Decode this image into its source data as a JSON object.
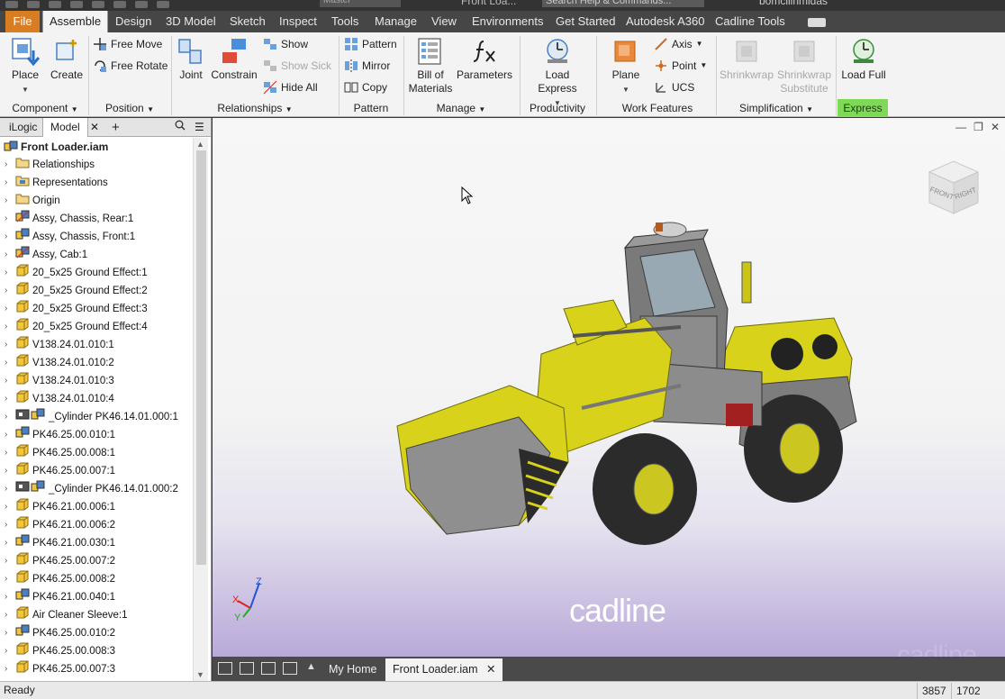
{
  "titlebar": {
    "design_view": "Master",
    "doc_title": "Front Loa...",
    "search_placeholder": "Search Help & Commands...",
    "user": "bomcilinmidas"
  },
  "tabs": {
    "file": "File",
    "items": [
      "Assemble",
      "Design",
      "3D Model",
      "Sketch",
      "Inspect",
      "Tools",
      "Manage",
      "View",
      "Environments",
      "Get Started",
      "Autodesk A360",
      "Cadline Tools"
    ]
  },
  "ribbon": {
    "component": {
      "place": "Place",
      "create": "Create",
      "label": "Component"
    },
    "position": {
      "free_move": "Free Move",
      "free_rotate": "Free Rotate",
      "label": "Position"
    },
    "relationships": {
      "joint": "Joint",
      "constrain": "Constrain",
      "show": "Show",
      "show_sick": "Show Sick",
      "hide_all": "Hide All",
      "label": "Relationships"
    },
    "pattern": {
      "pattern": "Pattern",
      "mirror": "Mirror",
      "copy": "Copy",
      "label": "Pattern"
    },
    "manage": {
      "bom_line1": "Bill of",
      "bom_line2": "Materials",
      "parameters": "Parameters",
      "label": "Manage"
    },
    "productivity": {
      "load_express": "Load Express",
      "label": "Productivity"
    },
    "work_features": {
      "plane": "Plane",
      "axis": "Axis",
      "point": "Point",
      "ucs": "UCS",
      "label": "Work Features"
    },
    "simplification": {
      "shrinkwrap": "Shrinkwrap",
      "shrinkwrap_sub_1": "Shrinkwrap",
      "shrinkwrap_sub_2": "Substitute",
      "label": "Simplification"
    },
    "express": {
      "load_full": "Load Full",
      "label": "Express"
    }
  },
  "browser": {
    "tabs": [
      "iLogic",
      "Model"
    ],
    "root": "Front Loader.iam",
    "items": [
      {
        "label": "Relationships",
        "icon": "folder"
      },
      {
        "label": "Representations",
        "icon": "folder-rep"
      },
      {
        "label": "Origin",
        "icon": "folder"
      },
      {
        "label": "Assy, Chassis, Rear:1",
        "icon": "subassembly-flex"
      },
      {
        "label": "Assy, Chassis, Front:1",
        "icon": "subassembly"
      },
      {
        "label": "Assy, Cab:1",
        "icon": "subassembly-flex"
      },
      {
        "label": "20_5x25 Ground Effect:1",
        "icon": "part"
      },
      {
        "label": "20_5x25 Ground Effect:2",
        "icon": "part"
      },
      {
        "label": "20_5x25 Ground Effect:3",
        "icon": "part"
      },
      {
        "label": "20_5x25 Ground Effect:4",
        "icon": "part"
      },
      {
        "label": "V138.24.01.010:1",
        "icon": "part"
      },
      {
        "label": "V138.24.01.010:2",
        "icon": "part"
      },
      {
        "label": "V138.24.01.010:3",
        "icon": "part"
      },
      {
        "label": "V138.24.01.010:4",
        "icon": "part"
      },
      {
        "label": "_Cylinder PK46.14.01.000:1",
        "icon": "cylinder"
      },
      {
        "label": "PK46.25.00.010:1",
        "icon": "subassembly"
      },
      {
        "label": "PK46.25.00.008:1",
        "icon": "part"
      },
      {
        "label": "PK46.25.00.007:1",
        "icon": "part"
      },
      {
        "label": "_Cylinder PK46.14.01.000:2",
        "icon": "cylinder"
      },
      {
        "label": "PK46.21.00.006:1",
        "icon": "part"
      },
      {
        "label": "PK46.21.00.006:2",
        "icon": "part"
      },
      {
        "label": "PK46.21.00.030:1",
        "icon": "subassembly"
      },
      {
        "label": "PK46.25.00.007:2",
        "icon": "part"
      },
      {
        "label": "PK46.25.00.008:2",
        "icon": "part"
      },
      {
        "label": "PK46.21.00.040:1",
        "icon": "subassembly"
      },
      {
        "label": "Air Cleaner Sleeve:1",
        "icon": "part"
      },
      {
        "label": "PK46.25.00.010:2",
        "icon": "subassembly"
      },
      {
        "label": "PK46.25.00.008:3",
        "icon": "part"
      },
      {
        "label": "PK46.25.00.007:3",
        "icon": "part"
      }
    ]
  },
  "viewport": {
    "viewcube_front": "FRONT",
    "viewcube_right": "RIGHT",
    "watermark": "cadline",
    "triad": {
      "x": "X",
      "y": "Y",
      "z": "Z"
    }
  },
  "doctabs": {
    "home": "My Home",
    "active": "Front Loader.iam"
  },
  "status": {
    "text": "Ready",
    "count1": "3857",
    "count2": "1702"
  },
  "colors": {
    "file_tab": "#d97d22",
    "express": "#7ed957",
    "loader_yellow": "#d8d21a",
    "watermark_logo": "#c0145e"
  }
}
